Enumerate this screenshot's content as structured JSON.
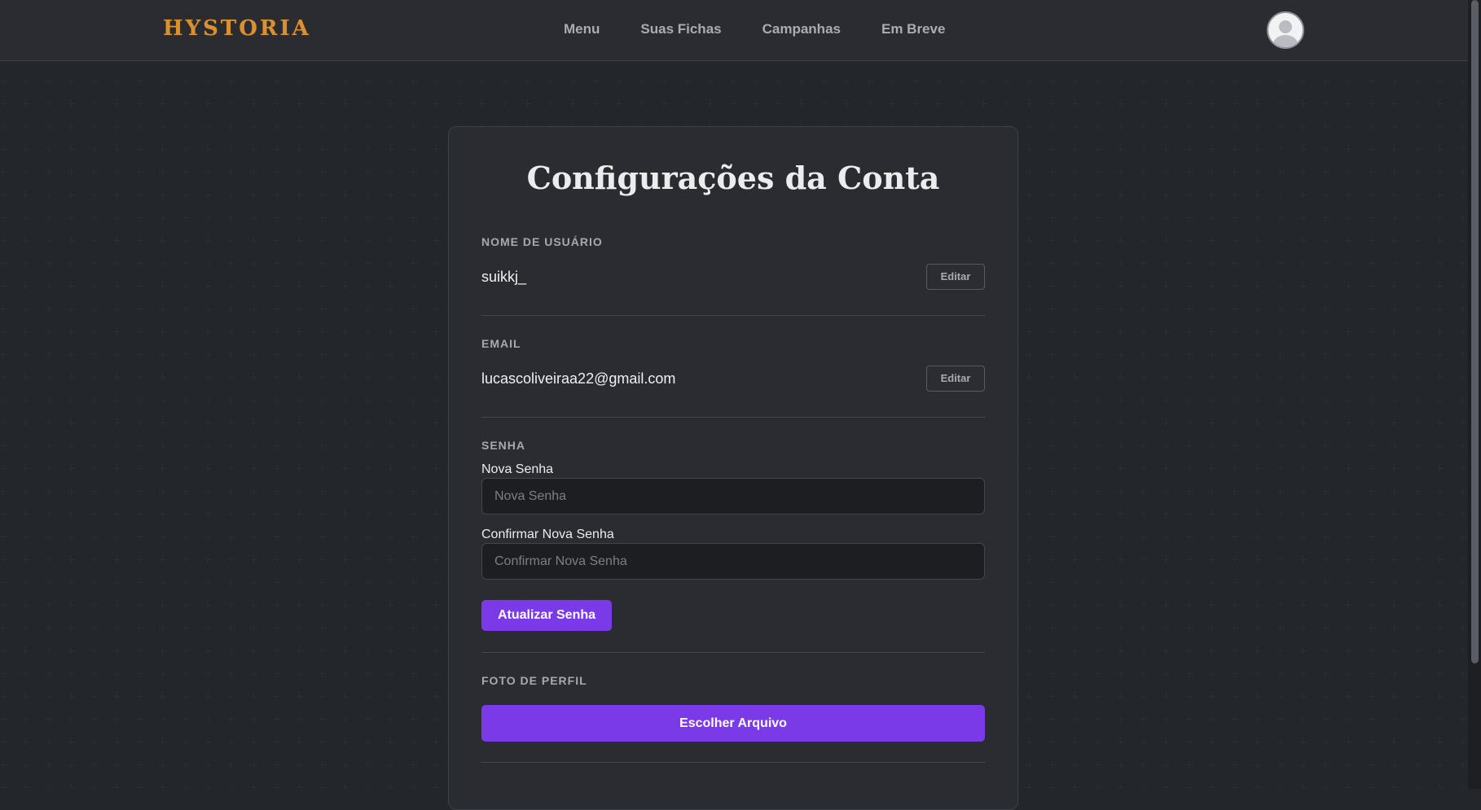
{
  "navbar": {
    "logo_text": "HYSTORIA",
    "links": [
      "Menu",
      "Suas Fichas",
      "Campanhas",
      "Em Breve"
    ]
  },
  "settings": {
    "title": "Configurações da Conta",
    "username": {
      "label": "NOME DE USUÁRIO",
      "value": "suikkj_",
      "edit_label": "Editar"
    },
    "email": {
      "label": "EMAIL",
      "value": "lucascoliveiraa22@gmail.com",
      "edit_label": "Editar"
    },
    "password": {
      "label": "SENHA",
      "new_label": "Nova Senha",
      "new_placeholder": "Nova Senha",
      "confirm_label": "Confirmar Nova Senha",
      "confirm_placeholder": "Confirmar Nova Senha",
      "submit_label": "Atualizar Senha"
    },
    "photo": {
      "label": "FOTO DE PERFIL",
      "button_label": "Escolher Arquivo"
    }
  },
  "colors": {
    "accent": "#7b3ae8",
    "logo": "#d9922f",
    "background": "#1b1d21",
    "card": "#2a2c32"
  }
}
